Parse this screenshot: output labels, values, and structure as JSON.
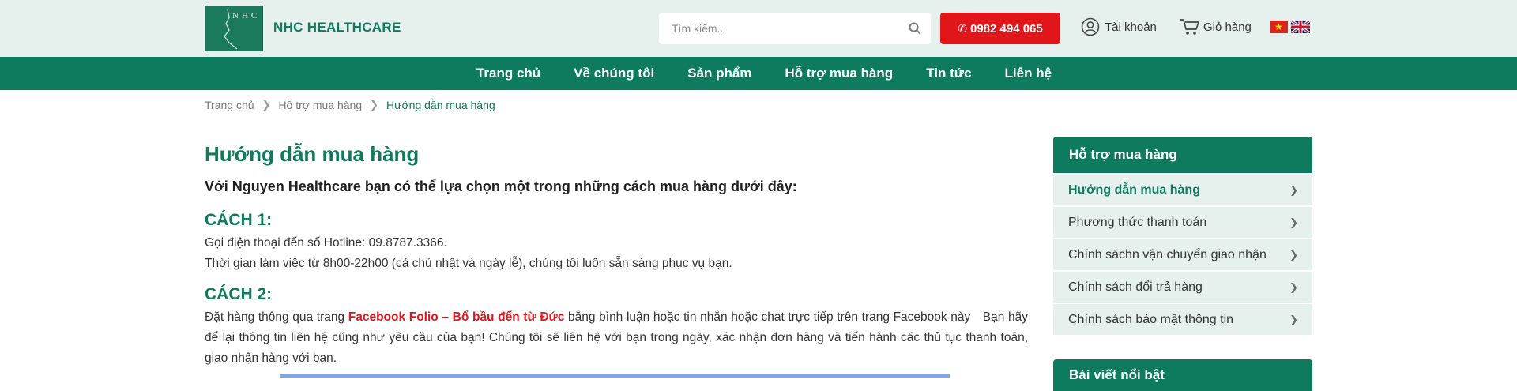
{
  "header": {
    "logo_text": "NHC",
    "brand": "NHC HEALTHCARE",
    "search_placeholder": "Tìm kiếm...",
    "hotline": "0982 494 065",
    "account_label": "Tài khoản",
    "cart_label": "Giỏ hàng"
  },
  "nav": {
    "items": [
      "Trang chủ",
      "Về chúng tôi",
      "Sản phẩm",
      "Hỗ trợ mua hàng",
      "Tin tức",
      "Liên hệ"
    ]
  },
  "breadcrumb": {
    "items": [
      "Trang chủ",
      "Hỗ trợ mua hàng",
      "Hướng dẫn mua hàng"
    ]
  },
  "main": {
    "title": "Hướng dẫn mua hàng",
    "intro": "Với Nguyen Healthcare bạn có thể lựa chọn một trong những cách mua hàng dưới đây:",
    "method1_title": "CÁCH 1:",
    "method1_line1": "Gọi điện thoại đến số Hotline: 09.8787.3366.",
    "method1_line2": "Thời gian làm việc từ 8h00-22h00 (cả chủ nhật và ngày lễ), chúng tôi luôn sẵn sàng phục vụ bạn.",
    "method2_title": "CÁCH 2:",
    "method2_pre": "Đặt hàng thông qua trang ",
    "method2_link": "Facebook Folio – Bổ bầu đến từ Đức",
    "method2_post": " bằng bình luận hoặc tin nhắn hoặc chat trực tiếp trên trang Facebook này Bạn hãy để lại thông tin liên hệ cũng như yêu cầu của bạn! Chúng tôi sẽ liên hệ với bạn trong ngày, xác nhận đơn hàng và tiến hành các thủ tục thanh toán, giao nhận hàng với bạn."
  },
  "sidebar": {
    "heading": "Hỗ trợ mua hàng",
    "items": [
      {
        "label": "Hướng dẫn mua hàng",
        "active": true
      },
      {
        "label": "Phương thức thanh toán",
        "active": false
      },
      {
        "label": "Chính sáchn vận chuyển giao nhận",
        "active": false
      },
      {
        "label": "Chính sách đổi trả hàng",
        "active": false
      },
      {
        "label": "Chính sách bảo mật thông tin",
        "active": false
      }
    ],
    "heading2": "Bài viết nổi bật"
  },
  "colors": {
    "brand_green": "#0e7a5e",
    "header_bg": "#e6f1ee",
    "hotline_red": "#e0161b"
  },
  "icons": {
    "search": "search-icon",
    "phone": "phone-icon",
    "account": "user-circle-icon",
    "cart": "cart-icon",
    "chevron": "chevron-right-icon"
  }
}
